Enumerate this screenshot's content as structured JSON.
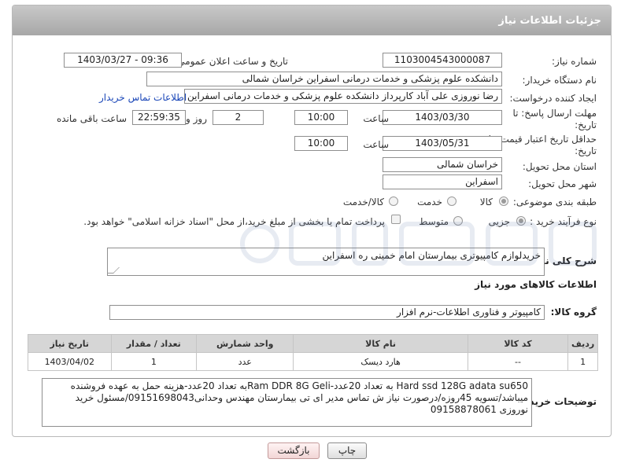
{
  "header": {
    "title": "جزئیات اطلاعات نیاز"
  },
  "fields": {
    "need_number": {
      "label": "شماره نیاز:",
      "value": "1103004543000087"
    },
    "announce_datetime": {
      "label": "تاریخ و ساعت اعلان عمومی:",
      "value": "1403/03/27 - 09:36"
    },
    "buyer_org": {
      "label": "نام دستگاه خریدار:",
      "value": "دانشکده علوم پزشکی و خدمات درمانی اسفراین خراسان شمالی"
    },
    "requester": {
      "label": "ایجاد کننده درخواست:",
      "value": "رضا نوروزی علی آباد کارپرداز  دانشکده علوم پزشکی و خدمات درمانی اسفراین خ",
      "contact_link": "اطلاعات تماس خریدار"
    },
    "reply_deadline": {
      "label_line1": "مهلت ارسال پاسخ: تا",
      "label_line2": "تاریخ:",
      "date": "1403/03/30",
      "time_label": "ساعت",
      "time": "10:00",
      "days": "2",
      "days_label": "روز و",
      "remaining": "22:59:35",
      "remaining_label": "ساعت باقی مانده"
    },
    "price_validity": {
      "label_line1": "حداقل تاریخ اعتبار قیمت: تا",
      "label_line2": "تاریخ:",
      "date": "1403/05/31",
      "time_label": "ساعت",
      "time": "10:00"
    },
    "delivery_province": {
      "label": "استان محل تحویل:",
      "value": "خراسان شمالی"
    },
    "delivery_city": {
      "label": "شهر محل تحویل:",
      "value": "اسفراین"
    },
    "category": {
      "label": "طبقه بندی موضوعی:",
      "options": [
        "کالا",
        "خدمت",
        "کالا/خدمت"
      ],
      "selected": "کالا"
    },
    "purchase_type": {
      "label": "نوع فرآیند خرید :",
      "options": [
        "جزیی",
        "متوسط"
      ],
      "selected": "جزیی",
      "payment_note": "پرداخت تمام یا بخشی از مبلغ خرید،از محل \"اسناد خزانه اسلامی\" خواهد بود."
    }
  },
  "summary": {
    "label": "شرح کلی نیاز:",
    "value": "خریدلوازم کامپیوتری بیمارستان امام خمینی ره اسفراین"
  },
  "goods_info": {
    "title": "اطلاعات کالاهای مورد نیاز",
    "group_label": "گروه کالا:",
    "group_value": "کامپیوتر و فناوری اطلاعات-نرم افزار"
  },
  "table": {
    "headers": [
      "ردیف",
      "کد کالا",
      "نام کالا",
      "واحد شمارش",
      "تعداد / مقدار",
      "تاریخ نیاز"
    ],
    "rows": [
      [
        "1",
        "--",
        "هارد دیسک",
        "عدد",
        "1",
        "1403/04/02"
      ]
    ]
  },
  "buyer_notes": {
    "label": "توضیحات خریدار:",
    "value": "Hard ssd 128G   adata su650 به تعداد 20عدد-Ram DDR 8G  Geliبه تعداد 20عدد-هزینه حمل به عهده فروشنده میباشد/تسویه 45روزه/درصورت نیاز ش تماس مدیر ای تی بیمارستان مهندس وحدانی09151698043/مسئول خرید نوروزی 09158878061"
  },
  "buttons": {
    "print": "چاپ",
    "back": "بازگشت"
  },
  "colors": {
    "header_bg": "#b3b3b3",
    "link": "#1b47b8",
    "table_header_bg": "#d6d6d6"
  }
}
